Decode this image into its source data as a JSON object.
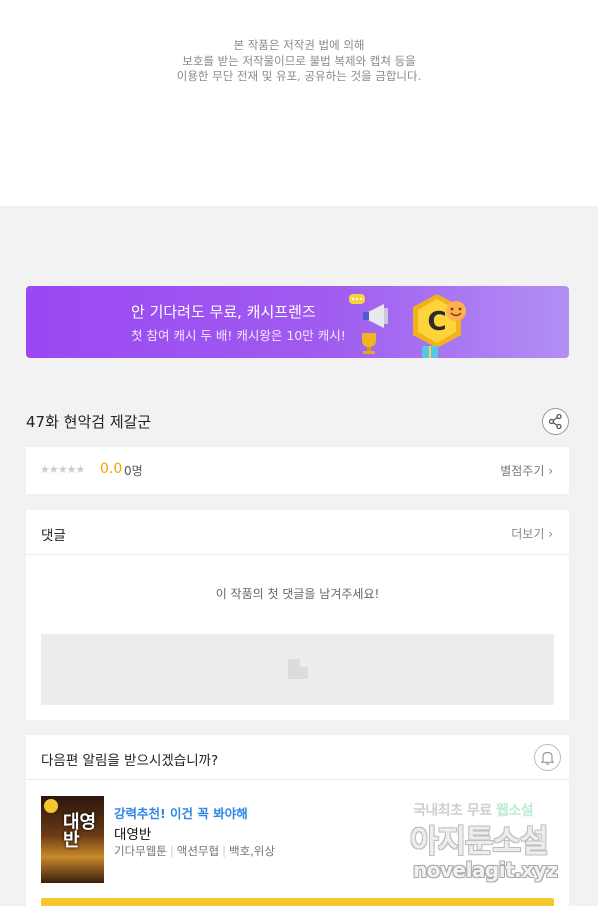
{
  "copyright": {
    "line1": "본 작품은 저작권 법에 의해",
    "line2": "보호를 받는 저작물이므로 불법 복제와 캡쳐 등을",
    "line3": "이용한 무단 전재 및 유포, 공유하는 것을 금합니다."
  },
  "banner": {
    "title": "안 기다려도 무료, 캐시프렌즈",
    "subtitle": "첫 참여 캐시 두 배! 캐시왕은 10만 캐시!",
    "coin_letter": "C",
    "gradient_start": "#9a48f2",
    "gradient_end": "#b28ff4"
  },
  "episode": {
    "title": "47화 현악검 제갈군",
    "share_icon": "share-icon"
  },
  "rating": {
    "stars": "★★★★★",
    "score": "0.0",
    "count": "0명",
    "rate_link": "별점주기 ›"
  },
  "comments": {
    "label": "댓글",
    "more": "더보기 ›",
    "empty_message": "이 작품의 첫 댓글을 남겨주세요!"
  },
  "notify": {
    "question": "다음편 알림을 받으시겠습니까?",
    "bell_icon": "bell-icon",
    "recommend_label": "강력추천! 이건 꼭 봐야해",
    "work_title": "대영반",
    "thumb_title": "대영반",
    "genre1": "기다무웹툰",
    "genre2": "액션무협",
    "author": "백호,위상",
    "accent": "#f7c62f"
  },
  "watermark": {
    "line1_gray": "국내최초 무료 ",
    "line1_green": "웹소설",
    "line2": "아지툰소설",
    "line3": "novelagit.xyz"
  }
}
